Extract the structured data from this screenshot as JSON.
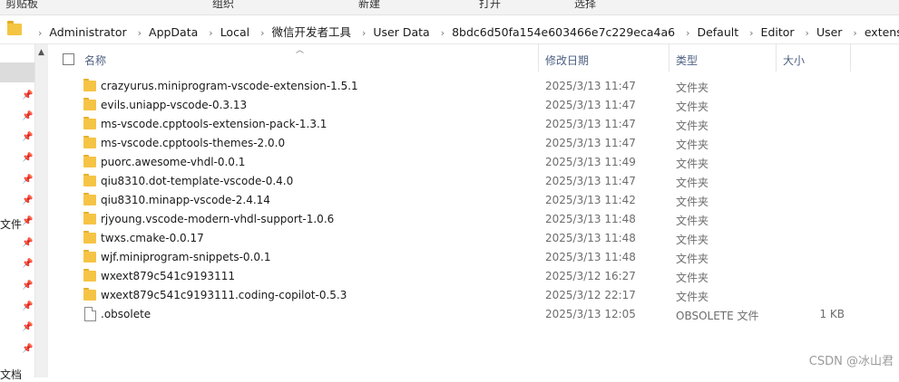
{
  "ribbon": {
    "items": [
      "剪贴板",
      "组织",
      "新建",
      "打开",
      "选择"
    ]
  },
  "address": {
    "crumbs": [
      "Administrator",
      "AppData",
      "Local",
      "微信开发者工具",
      "User Data",
      "8bdc6d50fa154e603466e7c229eca4a6",
      "Default",
      "Editor",
      "User",
      "extensions"
    ]
  },
  "nav": {
    "labels": [
      "文件",
      "文档"
    ]
  },
  "columns": {
    "name": "名称",
    "date": "修改日期",
    "type": "类型",
    "size": "大小"
  },
  "files": [
    {
      "name": "crazyurus.miniprogram-vscode-extension-1.5.1",
      "date": "2025/3/13 11:47",
      "type": "文件夹",
      "size": "",
      "kind": "folder"
    },
    {
      "name": "evils.uniapp-vscode-0.3.13",
      "date": "2025/3/13 11:47",
      "type": "文件夹",
      "size": "",
      "kind": "folder"
    },
    {
      "name": "ms-vscode.cpptools-extension-pack-1.3.1",
      "date": "2025/3/13 11:47",
      "type": "文件夹",
      "size": "",
      "kind": "folder"
    },
    {
      "name": "ms-vscode.cpptools-themes-2.0.0",
      "date": "2025/3/13 11:47",
      "type": "文件夹",
      "size": "",
      "kind": "folder"
    },
    {
      "name": "puorc.awesome-vhdl-0.0.1",
      "date": "2025/3/13 11:49",
      "type": "文件夹",
      "size": "",
      "kind": "folder"
    },
    {
      "name": "qiu8310.dot-template-vscode-0.4.0",
      "date": "2025/3/13 11:47",
      "type": "文件夹",
      "size": "",
      "kind": "folder"
    },
    {
      "name": "qiu8310.minapp-vscode-2.4.14",
      "date": "2025/3/13 11:42",
      "type": "文件夹",
      "size": "",
      "kind": "folder"
    },
    {
      "name": "rjyoung.vscode-modern-vhdl-support-1.0.6",
      "date": "2025/3/13 11:48",
      "type": "文件夹",
      "size": "",
      "kind": "folder"
    },
    {
      "name": "twxs.cmake-0.0.17",
      "date": "2025/3/13 11:48",
      "type": "文件夹",
      "size": "",
      "kind": "folder"
    },
    {
      "name": "wjf.miniprogram-snippets-0.0.1",
      "date": "2025/3/13 11:48",
      "type": "文件夹",
      "size": "",
      "kind": "folder"
    },
    {
      "name": "wxext879c541c9193111",
      "date": "2025/3/12 16:27",
      "type": "文件夹",
      "size": "",
      "kind": "folder"
    },
    {
      "name": "wxext879c541c9193111.coding-copilot-0.5.3",
      "date": "2025/3/12 22:17",
      "type": "文件夹",
      "size": "",
      "kind": "folder"
    },
    {
      "name": ".obsolete",
      "date": "2025/3/13 12:05",
      "type": "OBSOLETE 文件",
      "size": "1 KB",
      "kind": "file"
    }
  ],
  "watermark": "CSDN @冰山君"
}
